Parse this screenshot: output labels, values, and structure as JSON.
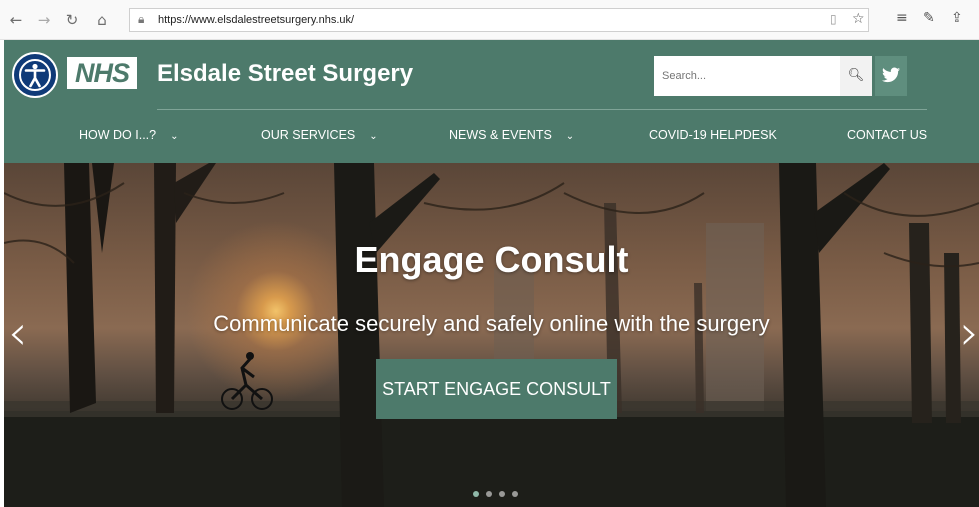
{
  "browser": {
    "url": "https://www.elsdalestreetsurgery.nhs.uk/",
    "back_icon": "arrow-left-icon",
    "forward_icon": "arrow-right-icon",
    "refresh_icon": "refresh-icon",
    "home_icon": "home-icon"
  },
  "header": {
    "nhs_logo": "NHS",
    "title": "Elsdale Street Surgery",
    "search_placeholder": "Search...",
    "accent_color": "#4d7a6b"
  },
  "nav": {
    "items": [
      {
        "label": "HOW DO I...?",
        "has_dropdown": true
      },
      {
        "label": "OUR SERVICES",
        "has_dropdown": true
      },
      {
        "label": "NEWS & EVENTS",
        "has_dropdown": true
      },
      {
        "label": "COVID-19 HELPDESK",
        "has_dropdown": false
      },
      {
        "label": "CONTACT US",
        "has_dropdown": false
      }
    ]
  },
  "hero": {
    "title": "Engage Consult",
    "subtitle": "Communicate securely and safely online with the surgery",
    "cta_label": "START ENGAGE CONSULT",
    "slide_count": 4,
    "active_slide": 1
  }
}
